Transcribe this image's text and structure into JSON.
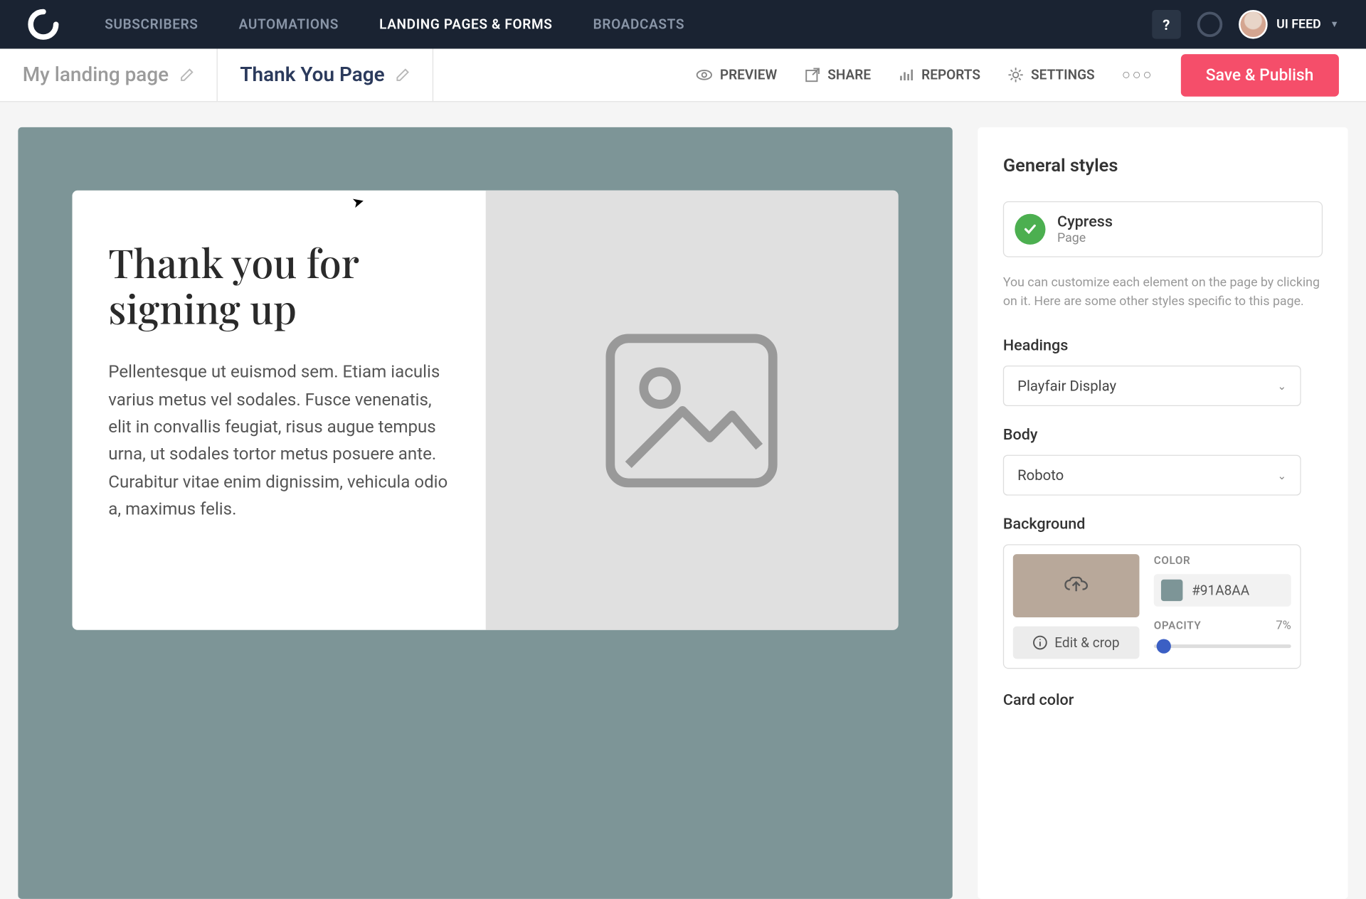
{
  "topNav": {
    "links": [
      "SUBSCRIBERS",
      "AUTOMATIONS",
      "LANDING PAGES & FORMS",
      "BROADCASTS"
    ],
    "activeIndex": 2,
    "helpLabel": "?",
    "username": "UI FEED"
  },
  "subHeader": {
    "tabs": [
      {
        "label": "My landing page",
        "active": false
      },
      {
        "label": "Thank You Page",
        "active": true
      }
    ],
    "actions": [
      "PREVIEW",
      "SHARE",
      "REPORTS",
      "SETTINGS"
    ],
    "saveLabel": "Save & Publish"
  },
  "canvas": {
    "heading": "Thank you for signing up",
    "body": "Pellentesque ut euismod sem. Etiam iaculis varius metus vel sodales. Fusce venenatis, elit in convallis feugiat, risus augue tempus urna, ut sodales tortor metus posuere ante. Curabitur vitae enim dignissim, vehicula odio a, maximus felis."
  },
  "sidebar": {
    "title": "General styles",
    "template": {
      "name": "Cypress",
      "sub": "Page"
    },
    "helpText": "You can customize each element on the page by clicking on it. Here are some other styles specific to this page.",
    "headingsLabel": "Headings",
    "headingsValue": "Playfair Display",
    "bodyLabel": "Body",
    "bodyValue": "Roboto",
    "bgLabel": "Background",
    "colorLabel": "COLOR",
    "colorHex": "#91A8AA",
    "editCropLabel": "Edit & crop",
    "opacityLabel": "OPACITY",
    "opacityValue": "7%",
    "cardColorLabel": "Card color"
  }
}
